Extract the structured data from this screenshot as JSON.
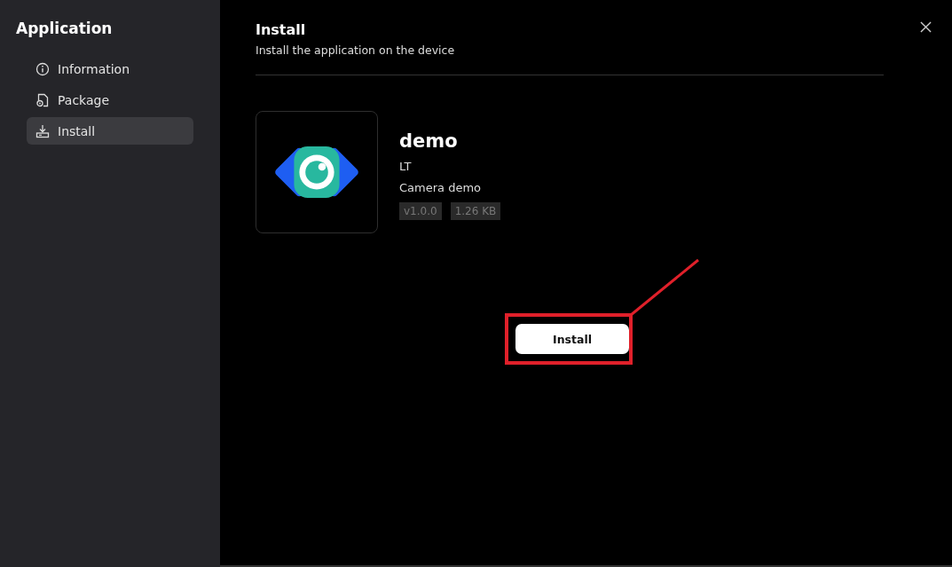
{
  "sidebar": {
    "title": "Application",
    "items": [
      {
        "label": "Information",
        "kind": "info",
        "selected": false
      },
      {
        "label": "Package",
        "kind": "package",
        "selected": false
      },
      {
        "label": "Install",
        "kind": "install",
        "selected": true
      }
    ]
  },
  "header": {
    "title": "Install",
    "subtitle": "Install the application on the device"
  },
  "app": {
    "name": "demo",
    "author": "LT",
    "description": "Camera demo",
    "tags": [
      "v1.0.0",
      "1.26 KB"
    ]
  },
  "install_button": {
    "label": "Install",
    "highlighted": true
  }
}
